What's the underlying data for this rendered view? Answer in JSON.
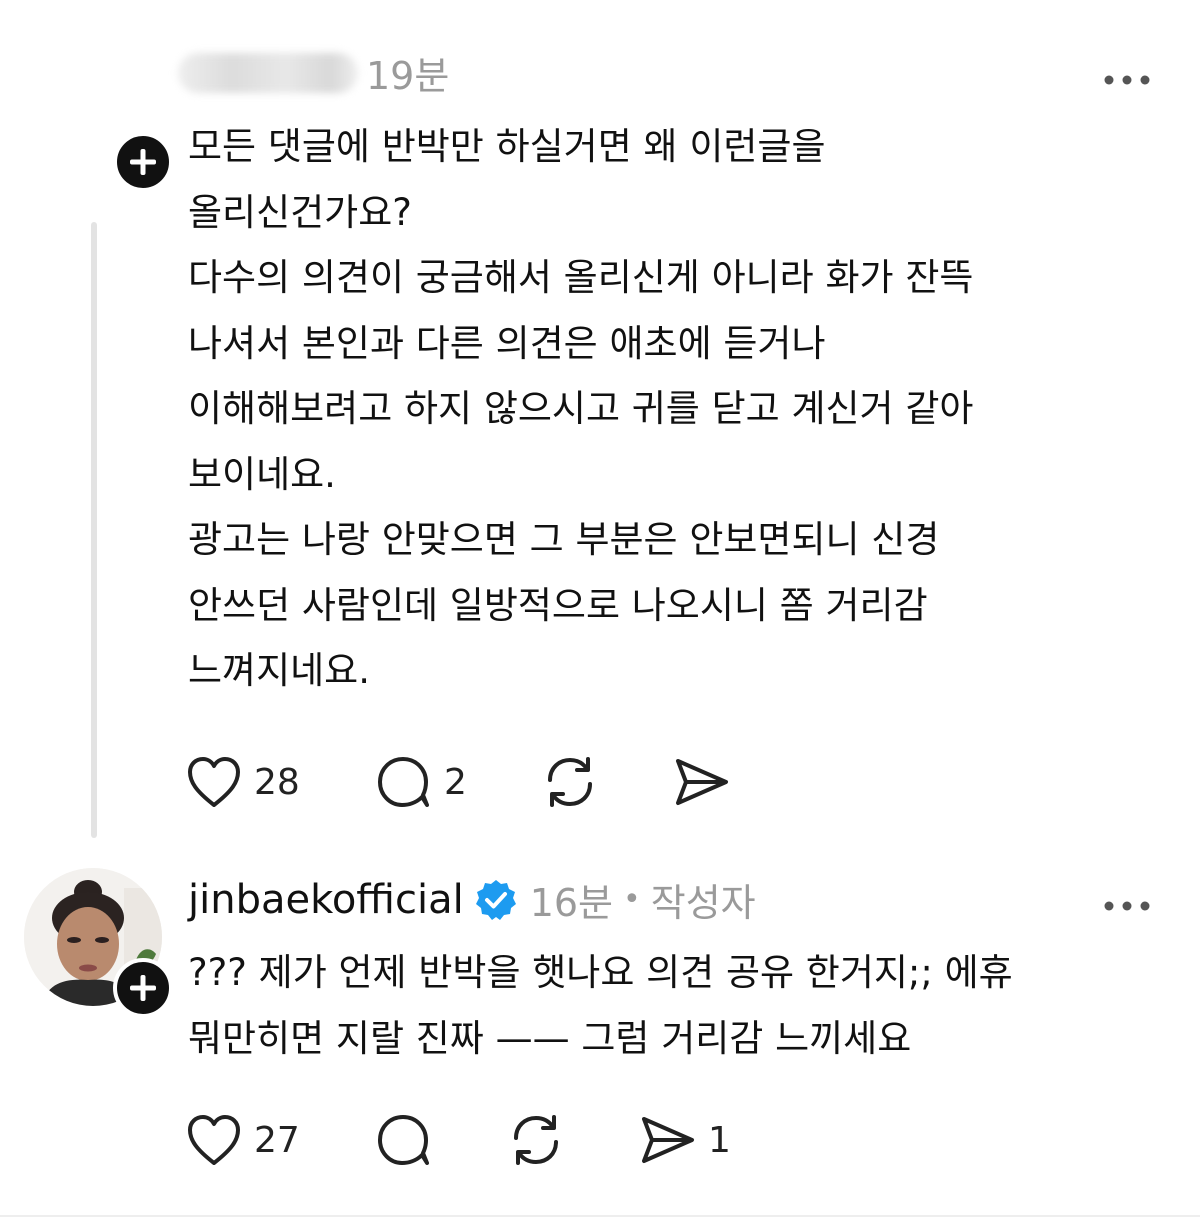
{
  "comments": [
    {
      "username_blurred": true,
      "time": "19분",
      "more_icon": "more-horizontal-icon",
      "follow_icon": "plus-icon",
      "text": "모든 댓글에 반박만 하실거면 왜 이런글을\n올리신건가요?\n다수의 의견이 궁금해서 올리신게 아니라 화가 잔뜩\n나셔서 본인과 다른 의견은 애초에 듣거나\n이해해보려고 하지 않으시고 귀를 닫고 계신거 같아\n보이네요.\n광고는 나랑 안맞으면 그 부분은 안보면되니 신경\n안쓰던 사람인데 일방적으로 나오시니 쫌 거리감\n느껴지네요.",
      "likes": "28",
      "replies": "2",
      "reposts": "",
      "shares": ""
    },
    {
      "username": "jinbaekofficial",
      "verified_icon": "verified-badge-icon",
      "time": "16분",
      "separator": "•",
      "author_tag": "작성자",
      "more_icon": "more-horizontal-icon",
      "follow_icon": "plus-icon",
      "text": "??? 제가 언제 반박을 햇나요 의견 공유 한거지;; 에휴\n뭐만히면 지랄 진짜 —— 그럼 거리감 느끼세요",
      "likes": "27",
      "replies": "",
      "reposts": "",
      "shares": "1"
    }
  ],
  "colors": {
    "text": "#111111",
    "meta": "#9a9a9a",
    "verified": "#1d9bf0",
    "thread_line": "#e3e3e3"
  }
}
